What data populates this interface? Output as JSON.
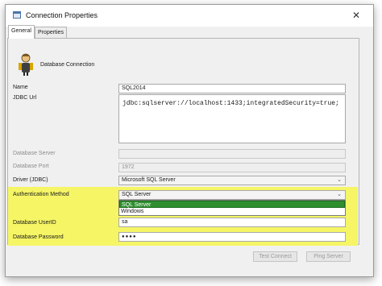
{
  "window": {
    "title": "Connection Properties",
    "close_glyph": "✕"
  },
  "tabs": [
    {
      "label": "General",
      "active": true
    },
    {
      "label": "Properties",
      "active": false
    }
  ],
  "header": {
    "icon": "person-database-icon",
    "label": "Database Connection"
  },
  "form": {
    "name": {
      "label": "Name",
      "value": "SQL2014"
    },
    "jdbc_url": {
      "label": "JDBC Url",
      "value": "jdbc:sqlserver://localhost:1433;integratedSecurity=true;"
    },
    "database_server": {
      "label": "Database Server",
      "value": ""
    },
    "database_port": {
      "label": "Database Port",
      "value": "1972"
    },
    "driver": {
      "label": "Driver (JDBC)",
      "value": "Microsoft SQL Server"
    },
    "auth_method": {
      "label": "Authentication Method",
      "value": "SQL Server",
      "options": [
        "SQL Server",
        "Windows"
      ]
    },
    "user_id": {
      "label": "Database UserID",
      "value": "sa"
    },
    "password": {
      "label": "Database Password",
      "value": "●●●●"
    }
  },
  "buttons": {
    "test_connect": "Test Connect",
    "ping_server": "Ping Server"
  },
  "colors": {
    "highlight": "#f5f566",
    "selected_option": "#2f8f2f",
    "title_icon": "#4a73a8"
  }
}
